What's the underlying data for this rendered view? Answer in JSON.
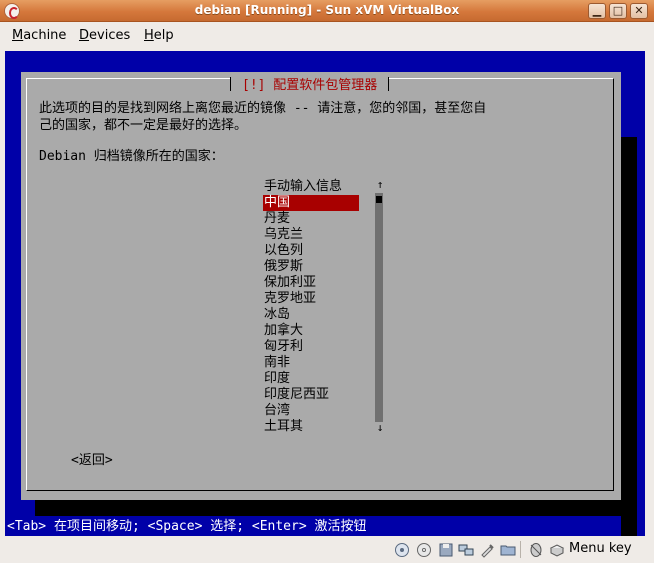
{
  "window": {
    "title": "debian [Running] - Sun xVM VirtualBox",
    "min_glyph": "▁",
    "max_glyph": "□",
    "close_glyph": "✕"
  },
  "menu": {
    "machine": {
      "u": "M",
      "rest": "achine"
    },
    "devices": {
      "u": "D",
      "rest": "evices"
    },
    "help": {
      "u": "H",
      "rest": "elp"
    }
  },
  "dialog": {
    "title": "[!] 配置软件包管理器",
    "description": "此选项的目的是找到网络上离您最近的镜像 -- 请注意，您的邻国，甚至您自\n己的国家，都不一定是最好的选择。",
    "prompt": "Debian 归档镜像所在的国家：",
    "items": [
      "手动输入信息",
      "中国",
      "丹麦",
      "乌克兰",
      "以色列",
      "俄罗斯",
      "保加利亚",
      "克罗地亚",
      "冰岛",
      "加拿大",
      "匈牙利",
      "南非",
      "印度",
      "印度尼西亚",
      "台湾",
      "土耳其"
    ],
    "selected_index": 1,
    "scroll_up": "↑",
    "scroll_down": "↓",
    "back_label": "<返回>"
  },
  "statusline": "<Tab> 在项目间移动; <Space> 选择; <Enter> 激活按钮",
  "vbox_status": {
    "host_key_label": "Menu key",
    "icons": [
      "hard-disk-icon",
      "cd-rom-icon",
      "floppy-icon",
      "network-icon",
      "usb-icon",
      "shared-folder-icon",
      "mouse-integration-icon",
      "host-key-icon"
    ]
  },
  "colors": {
    "titlebar": "#d5783c",
    "vm_background": "#0000a8",
    "dialog_background": "#aaaaaa",
    "title_text": "#a80000",
    "selection": "#a80000"
  }
}
